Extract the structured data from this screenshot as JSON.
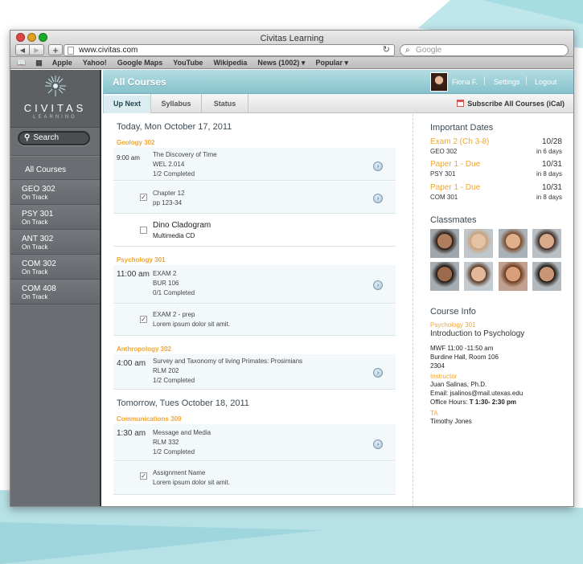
{
  "browser": {
    "window_title": "Civitas Learning",
    "url": "www.civitas.com",
    "search_placeholder": "Google",
    "bookmarks": [
      "Apple",
      "Yahoo!",
      "Google Maps",
      "YouTube",
      "Wikipedia",
      "News (1002) ▾",
      "Popular ▾"
    ]
  },
  "brand": {
    "name": "CIVITAS",
    "tagline": "LEARNING"
  },
  "sidebar": {
    "search_label": "Search",
    "all_courses": "All Courses",
    "courses": [
      {
        "code": "GEO 302",
        "status": "On Track"
      },
      {
        "code": "PSY 301",
        "status": "On Track"
      },
      {
        "code": "ANT 302",
        "status": "On Track"
      },
      {
        "code": "COM 302",
        "status": "On Track"
      },
      {
        "code": "COM 408",
        "status": "On Track"
      }
    ]
  },
  "header": {
    "title": "All Courses",
    "user": "Fiona F.",
    "settings": "Settings",
    "logout": "Logout"
  },
  "tabs": [
    "Up Next",
    "Syllabus",
    "Status"
  ],
  "subscribe": "Subscribe All Courses (iCal)",
  "feed": {
    "day1": "Today, Mon October 17, 2011",
    "day2": "Tomorrow, Tues October 18, 2011",
    "cat_geo": "Geology 302",
    "cat_psy": "Psychology 301",
    "cat_ant": "Anthropology 302",
    "cat_com": "Communications 309",
    "items": [
      {
        "time": "9:00 am",
        "title": "The Discovery of Time",
        "room": "WEL 2.014",
        "progress": "1/2 Completed"
      },
      {
        "title": "Chapter 12",
        "sub": "pp 123-34"
      },
      {
        "title": "Dino Cladogram",
        "sub": "Multimedia CD"
      },
      {
        "time": "11:00 am",
        "title": "EXAM 2",
        "room": "BUR 106",
        "progress": "0/1 Completed"
      },
      {
        "title": "EXAM 2 - prep",
        "sub": "Lorem ipsum dolor sit amit."
      },
      {
        "time": "4:00 am",
        "title": "Survey and Taxonomy of living Primates: Prosimians",
        "room": "RLM 202",
        "progress": "1/2 Completed"
      },
      {
        "time": "1:30 am",
        "title": "Message and Media",
        "room": "RLM 332",
        "progress": "1/2 Completed"
      },
      {
        "title": "Assignment Name",
        "sub": "Lorem ipsum dolor sit amit."
      }
    ]
  },
  "right": {
    "dates_title": "Important Dates",
    "dates": [
      {
        "name": "Exam 2 (Ch 3-8)",
        "date": "10/28",
        "course": "GEO 302",
        "in": "in 6 days"
      },
      {
        "name": "Paper 1 - Due",
        "date": "10/31",
        "course": "PSY 301",
        "in": "in 8 days"
      },
      {
        "name": "Paper 1 - Due",
        "date": "10/31",
        "course": "COM 301",
        "in": "in 8 days"
      }
    ],
    "classmates_title": "Classmates",
    "course_info_title": "Course Info",
    "course_code": "Psychology 301",
    "course_name": "Introduction to Psychology",
    "schedule": "MWF 11:00 -11:50 am",
    "location": "Burdine Hall, Room 106",
    "room_no": "2304",
    "instructor_label": "Instructor",
    "instructor": "Juan Salinas, Ph.D.",
    "email": "Email: jsalinos@mail.utexas.edu",
    "office_hours_label": "Office Hours:",
    "office_hours": "T 1:30- 2:30 pm",
    "ta_label": "TA",
    "ta": "Timothy Jones"
  },
  "colors": {
    "accent": "#f2a532",
    "header_teal": "#86c2cc",
    "sidebar": "#6a6e72"
  }
}
